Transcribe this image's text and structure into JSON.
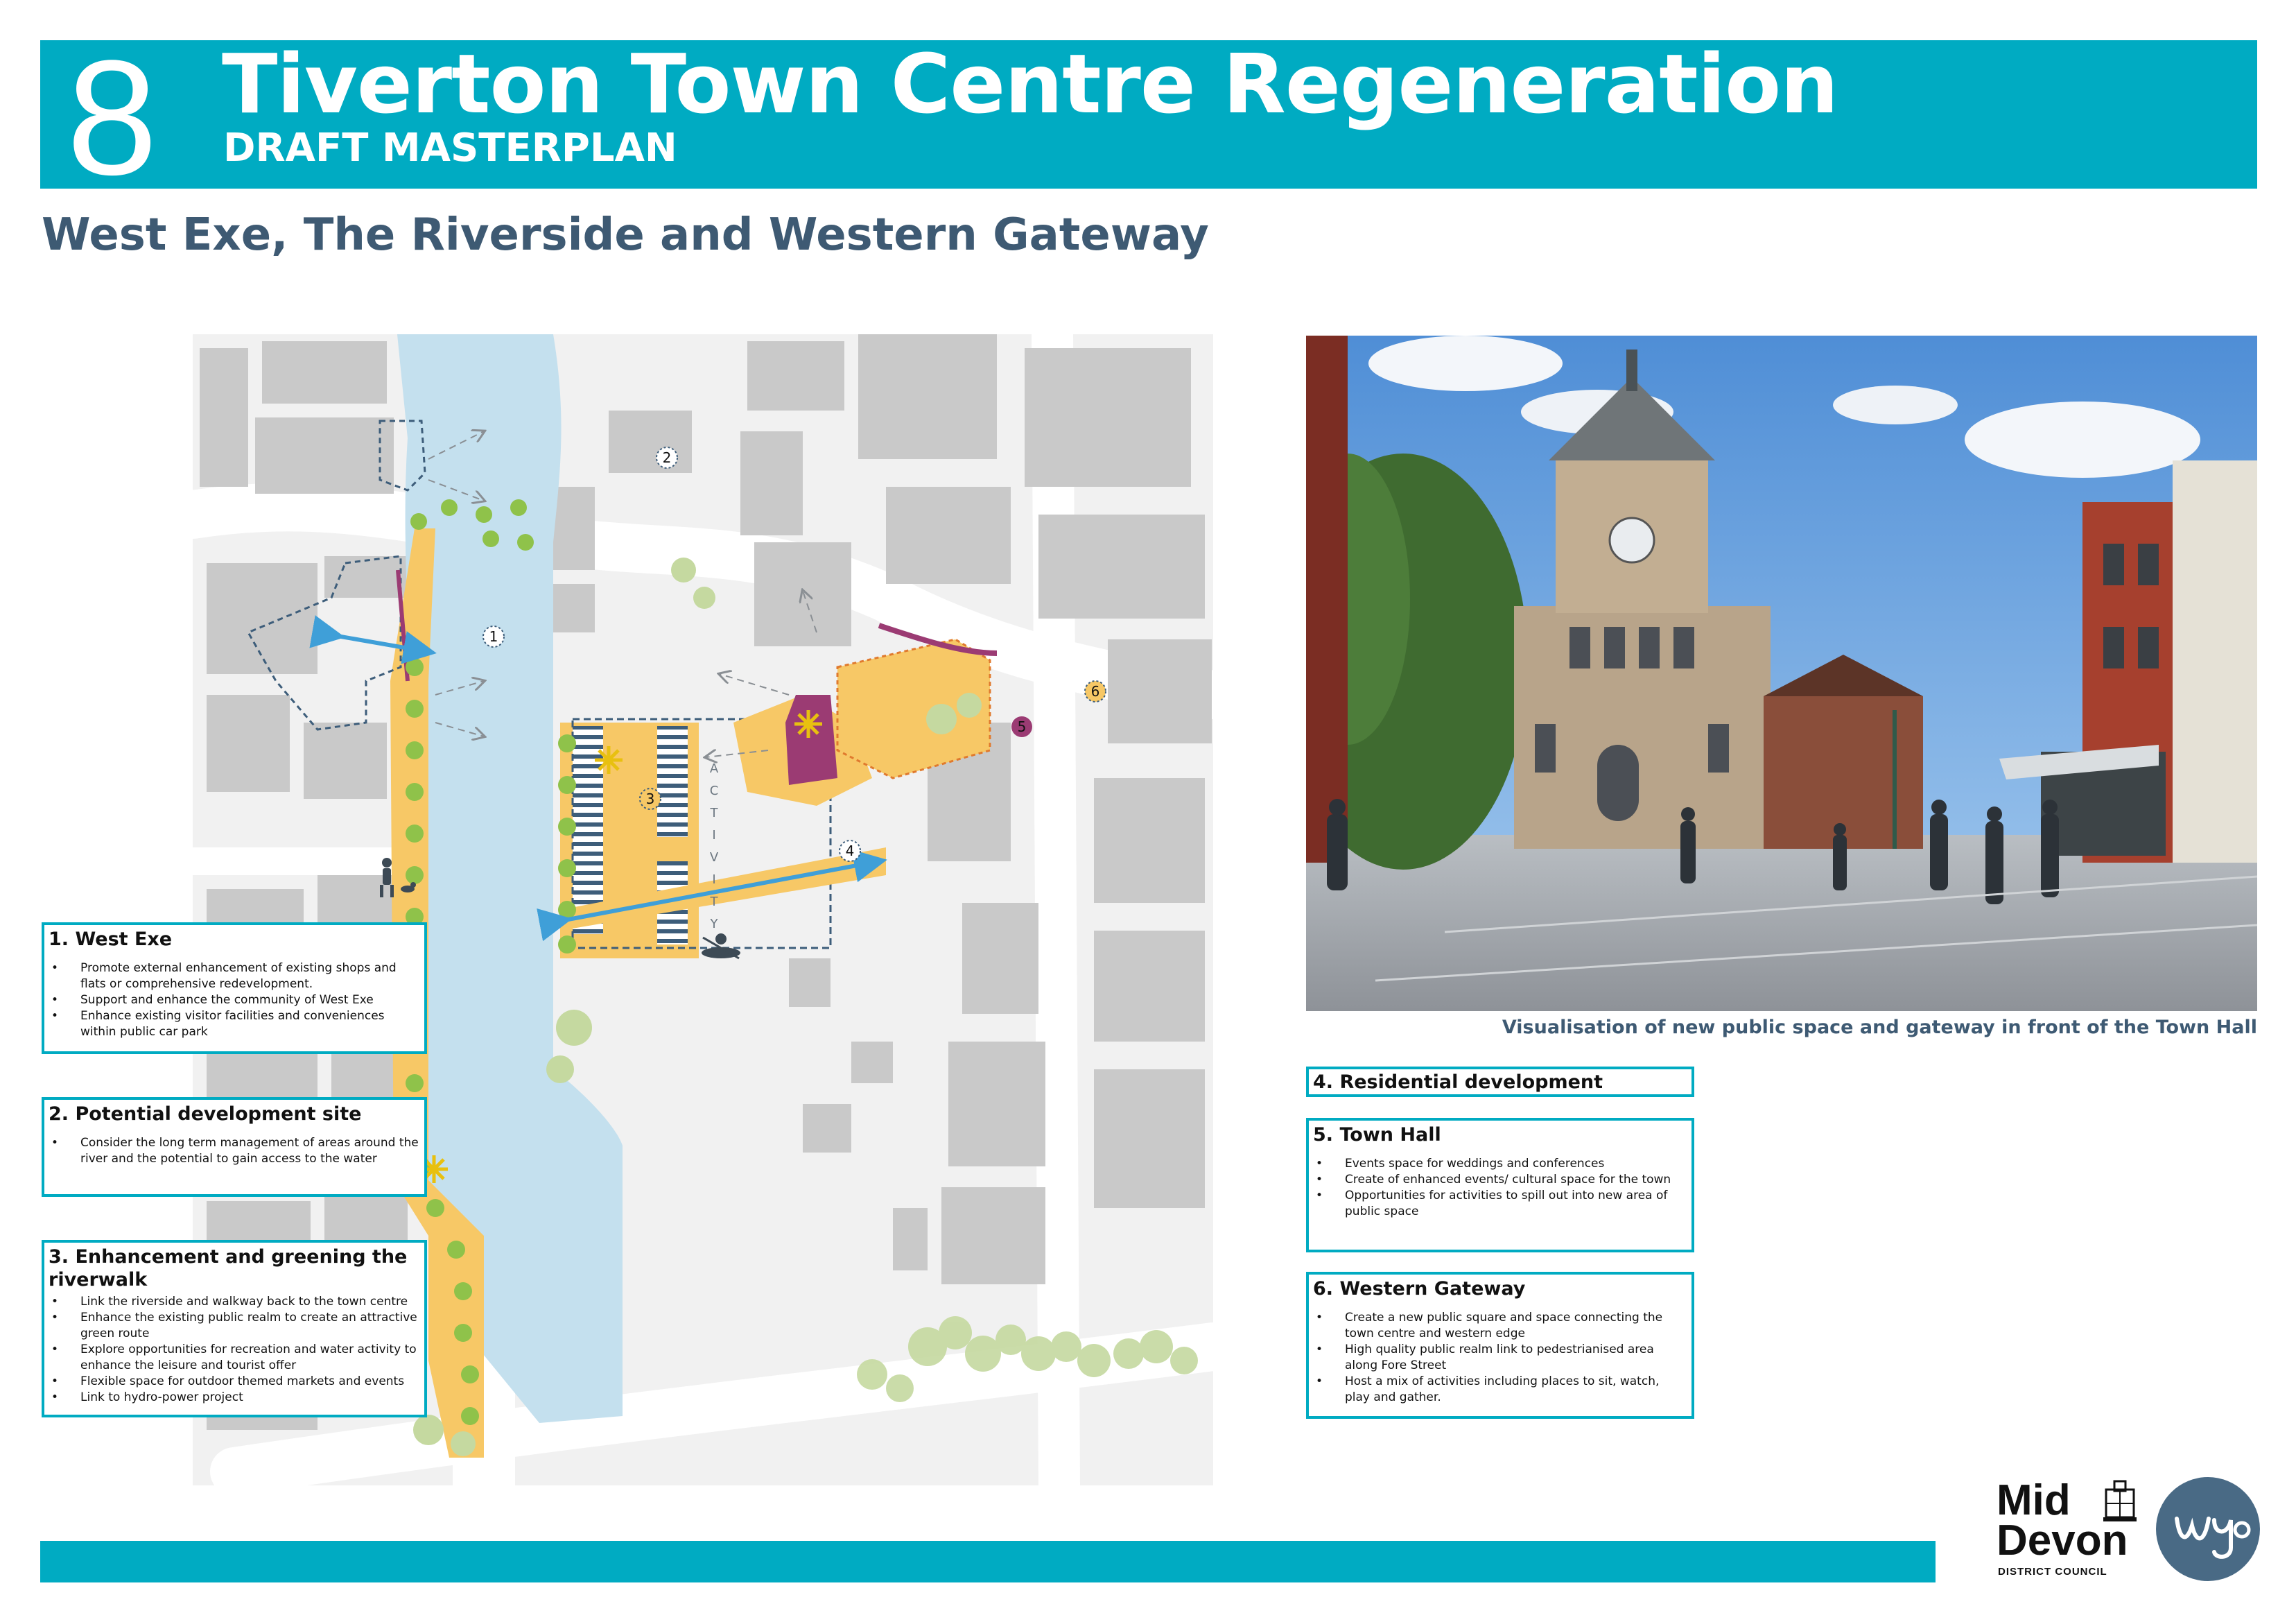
{
  "header": {
    "board_number": "8",
    "title": "Tiverton Town Centre Regeneration",
    "subtitle": "DRAFT MASTERPLAN"
  },
  "section_heading": "West Exe, The Riverside and Western Gateway",
  "map": {
    "river_label": "ACTIVITY",
    "markers": [
      "1",
      "2",
      "3",
      "4",
      "5",
      "6"
    ]
  },
  "photo": {
    "caption": "Visualisation of new public space and gateway in front of the Town Hall"
  },
  "info_boxes": [
    {
      "title": "1. West Exe",
      "items": [
        "Promote external enhancement of existing shops and flats or comprehensive redevelopment.",
        "Support and enhance the community of West Exe",
        "Enhance existing visitor facilities and conveniences within public car park"
      ]
    },
    {
      "title": "2. Potential development site",
      "items": [
        "Consider the long term management of areas around the river and the potential to gain access to the water"
      ]
    },
    {
      "title": "3. Enhancement and greening the riverwalk",
      "items": [
        "Link the riverside and walkway back to the town centre",
        "Enhance the existing public realm to create an attractive green route",
        "Explore opportunities for recreation and water activity to enhance the leisure and tourist offer",
        "Flexible space for outdoor themed markets and events",
        "Link to hydro-power project"
      ]
    },
    {
      "title": "4. Residential development",
      "items": []
    },
    {
      "title": "5. Town Hall",
      "items": [
        "Events space for weddings and conferences",
        "Create of enhanced events/ cultural space for the town",
        "Opportunities for activities to spill out into new area of public space"
      ]
    },
    {
      "title": "6. Western Gateway",
      "items": [
        "Create a new public square and space connecting the town centre and western edge",
        "High quality public realm link to pedestrianised area along Fore Street",
        "Host a mix of activities including places to sit, watch, play and gather."
      ]
    }
  ],
  "logos": {
    "mid": "Mid",
    "devon": "Devon",
    "council": "DISTRICT COUNCIL",
    "wyg": "wyg"
  },
  "colors": {
    "accent": "#00abc2",
    "heading": "#3e5a73",
    "river": "#c4e0ee",
    "walkway": "#f7c866",
    "tree": "#8fc24a",
    "route_arrow": "#3f9fd8",
    "town_hall": "#9b3b73"
  }
}
